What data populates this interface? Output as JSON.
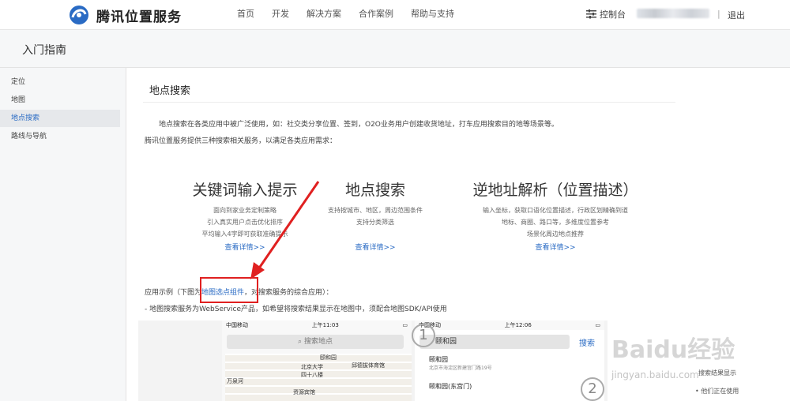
{
  "header": {
    "brand": "腾讯位置服务",
    "nav": [
      "首页",
      "开发",
      "解决方案",
      "合作案例",
      "帮助与支持"
    ],
    "console": "控制台",
    "separator": "|",
    "logout": "退出"
  },
  "subheader": {
    "title": "入门指南"
  },
  "sidebar": {
    "items": [
      {
        "label": "定位",
        "active": false
      },
      {
        "label": "地图",
        "active": false
      },
      {
        "label": "地点搜索",
        "active": true
      },
      {
        "label": "路线与导航",
        "active": false
      }
    ]
  },
  "main": {
    "section_title": "地点搜索",
    "intro_line1": "地点搜索在各类应用中被广泛使用，如：社交类分享位置、签到，O2O业务用户创建收货地址，打车应用搜索目的地等场景等。",
    "intro_line2": "腾讯位置服务提供三种搜索相关服务，以满足各类应用需求：",
    "features": [
      {
        "title": "关键词输入提示",
        "desc": [
          "面向到家业务定制策略",
          "引入真实用户点击优化排序",
          "平均输入4字即可获取准确提示"
        ],
        "more": "查看详情>>"
      },
      {
        "title": "地点搜索",
        "desc": [
          "支持按城市、地区，周边范围条件",
          "支持分类筛选"
        ],
        "more": "查看详情>>"
      },
      {
        "title": "逆地址解析（位置描述）",
        "desc": [
          "输入坐标，获取口语化位置描述，行政区划精确到道",
          "地标、商圈、路口等，多维度位置参考",
          "场景化周边地点推荐"
        ],
        "more": "查看详情>>"
      }
    ],
    "example_prefix": "应用示例（下图为",
    "example_link": "地图选点组件",
    "example_suffix": "，对搜索服务的综合应用）：",
    "note": "- 地图搜索服务为WebService产品，如希望将搜索结果显示在地图中，须配合地图SDK/API使用"
  },
  "screenshot": {
    "phone1": {
      "carrier": "中国移动",
      "time": "上午11:03",
      "search_placeholder": "搜索地点",
      "map_labels": [
        "北京大学",
        "四十八楼",
        "邱德拔体育馆",
        "资源宾馆",
        "颐和园",
        "万泉河"
      ]
    },
    "phone2": {
      "carrier": "中国移动",
      "time": "上午12:06",
      "query": "颐和园",
      "search_button": "搜索",
      "results": [
        {
          "name": "颐和园",
          "addr": "北京市海淀区新建宫门路19号"
        },
        {
          "name": "颐和园(东宫门)",
          "addr": ""
        }
      ],
      "marker1": "1",
      "marker2": "2"
    }
  },
  "right_panel": {
    "line1": "搜索结果显示",
    "line2": "他们正在使用"
  },
  "watermark": {
    "text": "Baidu经验",
    "sub": "jingyan.baidu.com"
  }
}
